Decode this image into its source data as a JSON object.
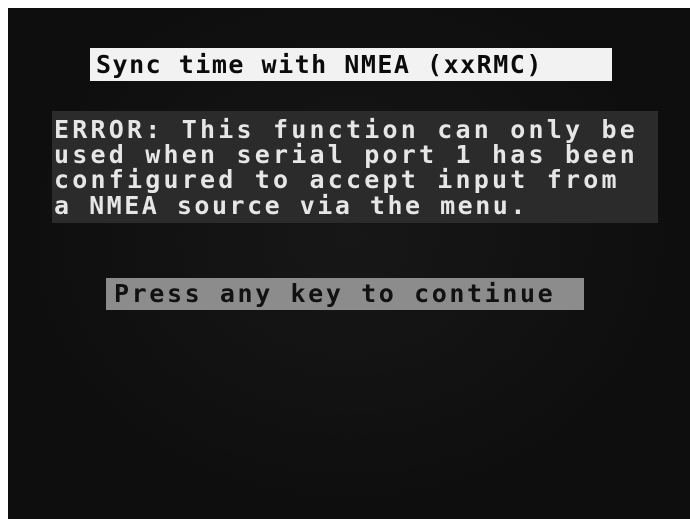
{
  "screen": {
    "title": "Sync time with NMEA (xxRMC)",
    "error_lines": [
      "ERROR: This function can only be",
      "used when serial port 1 has been",
      "configured to accept input from",
      "a NMEA source via the menu."
    ],
    "prompt": "Press any key to continue"
  },
  "colors": {
    "background": "#0e0e0e",
    "title_highlight": "#f2f2f2",
    "error_panel": "#2b2b2b",
    "prompt_highlight": "#8c8c8c"
  }
}
